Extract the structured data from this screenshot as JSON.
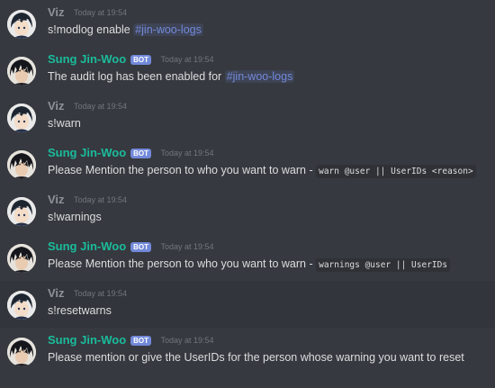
{
  "colors": {
    "background": "#36393f",
    "viz_name": "#8e9297",
    "bot_name": "#1abc9c",
    "bot_tag": "#7289da",
    "mention": "#7289da",
    "timestamp": "#72767d"
  },
  "icons": [
    "user-avatar-icon",
    "bot-avatar-icon"
  ],
  "messages": [
    {
      "author": "Viz",
      "is_bot": false,
      "timestamp": "Today at 19:54",
      "text": "s!modlog enable ",
      "mention": "#jin-woo-logs"
    },
    {
      "author": "Sung Jin-Woo",
      "is_bot": true,
      "bot_tag": "BOT",
      "timestamp": "Today at 19:54",
      "text": "The audit log has been enabled for ",
      "mention": "#jin-woo-logs"
    },
    {
      "author": "Viz",
      "is_bot": false,
      "timestamp": "Today at 19:54",
      "text": "s!warn"
    },
    {
      "author": "Sung Jin-Woo",
      "is_bot": true,
      "bot_tag": "BOT",
      "timestamp": "Today at 19:54",
      "text": "Please Mention the person to who you want to warn - ",
      "code": "warn @user || UserIDs <reason>"
    },
    {
      "author": "Viz",
      "is_bot": false,
      "timestamp": "Today at 19:54",
      "text": "s!warnings"
    },
    {
      "author": "Sung Jin-Woo",
      "is_bot": true,
      "bot_tag": "BOT",
      "timestamp": "Today at 19:54",
      "text": "Please Mention the person to who you want to warn - ",
      "code": "warnings @user || UserIDs"
    },
    {
      "author": "Viz",
      "is_bot": false,
      "timestamp": "Today at 19:54",
      "text": "s!resetwarns"
    },
    {
      "author": "Sung Jin-Woo",
      "is_bot": true,
      "bot_tag": "BOT",
      "timestamp": "Today at 19:54",
      "text": "Please mention or give the UserIDs for the person whose warning you want to reset"
    }
  ]
}
